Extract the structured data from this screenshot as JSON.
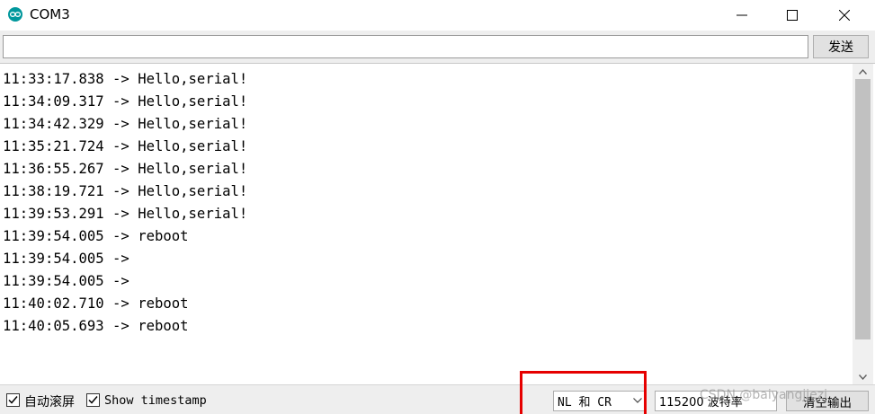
{
  "window": {
    "title": "COM3",
    "icon": "arduino-logo-icon",
    "controls": [
      "minimize-icon",
      "maximize-icon",
      "close-icon"
    ]
  },
  "send_bar": {
    "input_value": "",
    "input_placeholder": "",
    "send_label": "发送"
  },
  "output": {
    "lines": [
      "11:33:17.838 -> Hello,serial!",
      "11:34:09.317 -> Hello,serial!",
      "11:34:42.329 -> Hello,serial!",
      "11:35:21.724 -> Hello,serial!",
      "11:36:55.267 -> Hello,serial!",
      "11:38:19.721 -> Hello,serial!",
      "11:39:53.291 -> Hello,serial!",
      "11:39:54.005 -> reboot",
      "11:39:54.005 -> ",
      "11:39:54.005 -> ",
      "11:40:02.710 -> reboot",
      "11:40:05.693 -> reboot"
    ]
  },
  "status_bar": {
    "autoscroll_label": "自动滚屏",
    "autoscroll_checked": true,
    "timestamp_label": "Show timestamp",
    "timestamp_checked": true,
    "line_ending_value": "NL 和 CR",
    "baud_value": "115200 波特率",
    "clear_label": "清空输出"
  },
  "overlay": {
    "watermark": "CSDN @baiyangjiezi",
    "highlight_color": "#e60000"
  },
  "colors": {
    "accent": "#00979c",
    "highlight": "#e60000"
  }
}
